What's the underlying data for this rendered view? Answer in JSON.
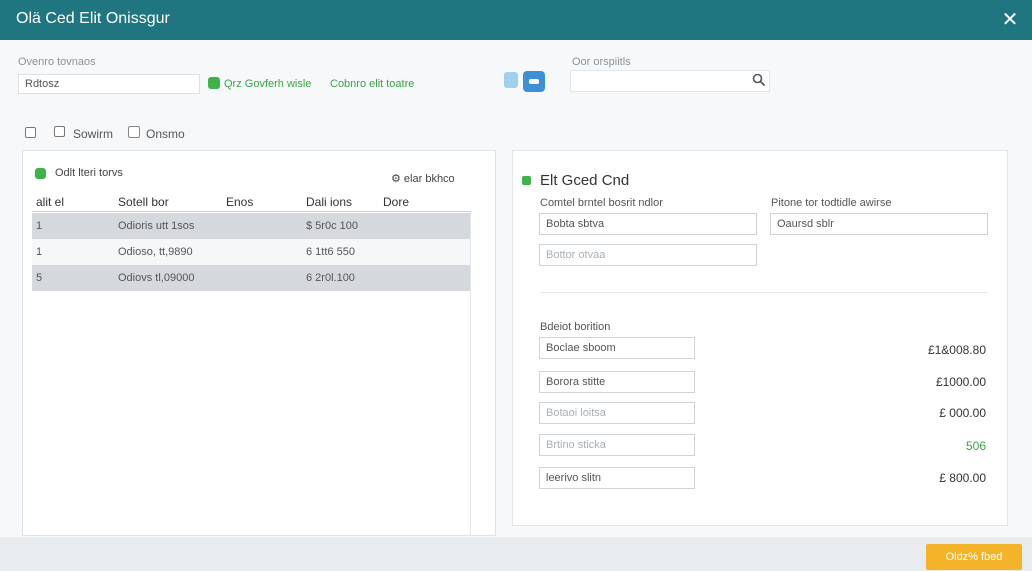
{
  "window": {
    "title": "Olä Ced Elit Onissgur",
    "close_glyph": "✕"
  },
  "toolbar": {
    "filter_label": "Ovenro tovnaos",
    "filter_value": "Rdtosz",
    "link1": "Qrz Govferh wisle",
    "link2": "Cobnro elit toatre",
    "search_label": "Oor orspiitls",
    "search_placeholder": ""
  },
  "options": {
    "opt1": "Sowirm",
    "opt2": "Onsmo"
  },
  "table": {
    "title": "Odlt lteri torvs",
    "action": "elar bkhco",
    "headers": [
      "alit el",
      "Sotell bor",
      "Enos",
      "Dali ions",
      "Dore"
    ],
    "rows": [
      [
        "1",
        "Odioris utt 1sos",
        "",
        "$ 5r0c 100",
        ""
      ],
      [
        "1",
        "Odioso, tt,9890",
        "",
        "6 1tt6 550",
        ""
      ],
      [
        "5",
        "Odiovs  tl,09000",
        "",
        "6 2r0l.100",
        ""
      ]
    ]
  },
  "detail": {
    "title": "Elt Gced Cnd",
    "label1": "Comtel brntel bosrit ndlor",
    "value1": "Bobta sbtva",
    "label2": "Pitone tor todtidle awirse",
    "value2": "Oaursd sblr",
    "value3": "Bottor otvaa",
    "section_label": "Bdeiot borition",
    "fields": [
      {
        "value": "Boclae sboom",
        "amount": "£1&008.80",
        "green": false,
        "faint": false
      },
      {
        "value": "Borora stitte",
        "amount": "£1000.00",
        "green": false,
        "faint": false
      },
      {
        "value": "Botaoi loitsa",
        "amount": "£ 000.00",
        "green": false,
        "faint": true
      },
      {
        "value": "Brtino sticka",
        "amount": "506",
        "green": true,
        "faint": true
      },
      {
        "value": "leerivo slitn",
        "amount": "£ 800.00",
        "green": false,
        "faint": false
      }
    ]
  },
  "footer": {
    "primary": "Oldz% fbed"
  },
  "colors": {
    "header": "#1f7580",
    "accent_green": "#3fb249",
    "primary_button": "#f3b429",
    "row_shade": "#d5d9dd"
  }
}
